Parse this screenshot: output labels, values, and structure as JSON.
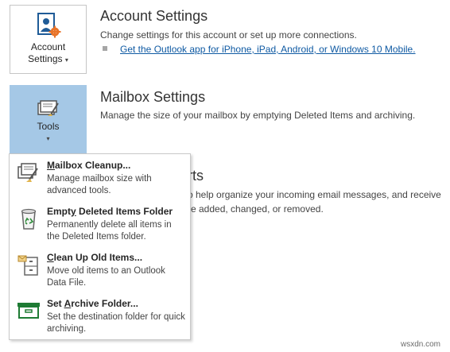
{
  "account": {
    "button_label_line1": "Account",
    "button_label_line2": "Settings",
    "title": "Account Settings",
    "description": "Change settings for this account or set up more connections.",
    "link": "Get the Outlook app for iPhone, iPad, Android, or Windows 10 Mobile."
  },
  "mailbox": {
    "button_label": "Tools",
    "title": "Mailbox Settings",
    "description": "Manage the size of your mailbox by emptying Deleted Items and archiving."
  },
  "rules_partial": {
    "title": "rts",
    "line1": "o help organize your incoming email messages, and receive",
    "line2": "re added, changed, or removed."
  },
  "menu": {
    "items": [
      {
        "title_pre": "",
        "title_ul": "M",
        "title_post": "ailbox Cleanup...",
        "desc": "Manage mailbox size with advanced tools.",
        "icon": "mailbox-cleanup-icon"
      },
      {
        "title_pre": "Empt",
        "title_ul": "y",
        "title_post": " Deleted Items Folder",
        "desc": "Permanently delete all items in the Deleted Items folder.",
        "icon": "recycle-bin-icon"
      },
      {
        "title_pre": "",
        "title_ul": "C",
        "title_post": "lean Up Old Items...",
        "desc": "Move old items to an Outlook Data File.",
        "icon": "archive-cabinet-icon"
      },
      {
        "title_pre": "Set ",
        "title_ul": "A",
        "title_post": "rchive Folder...",
        "desc": "Set the destination folder for quick archiving.",
        "icon": "archive-box-icon"
      }
    ]
  },
  "watermark": "wsxdn.com",
  "colors": {
    "tools_selected_bg": "#a5c8e6",
    "link": "#0f5aa3",
    "archive_green": "#1e7b34"
  }
}
